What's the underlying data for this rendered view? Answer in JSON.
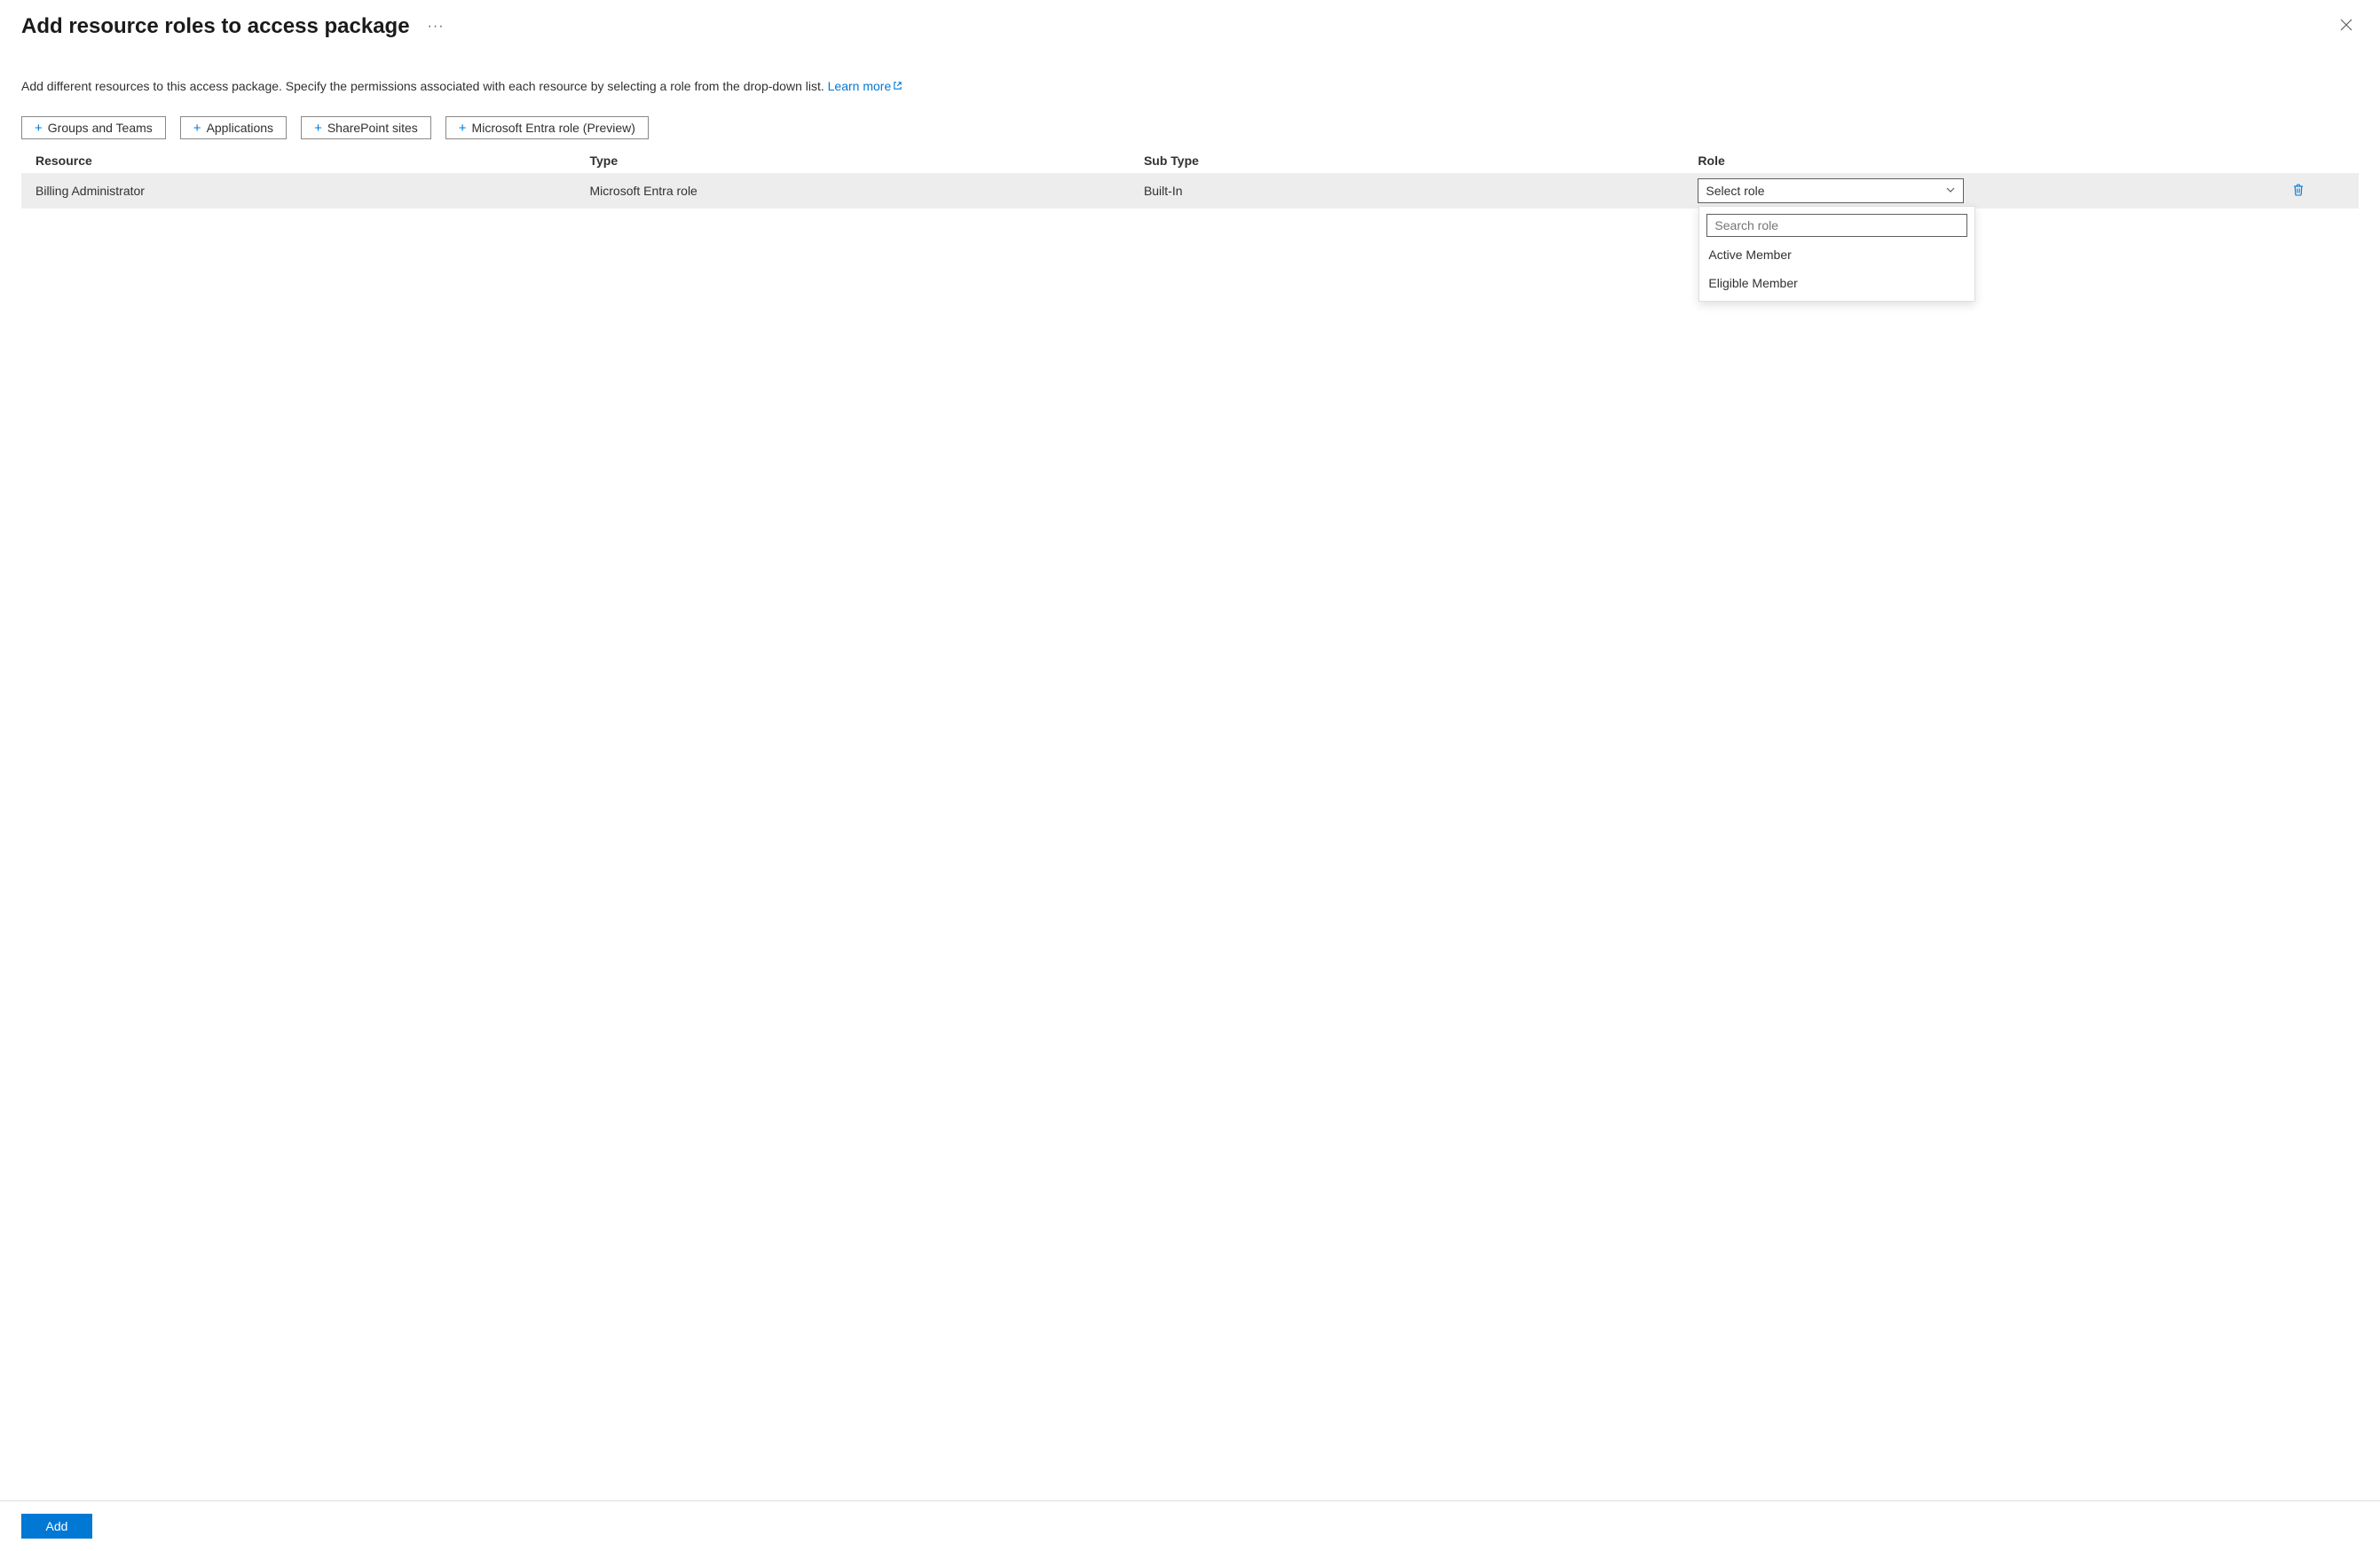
{
  "header": {
    "title": "Add resource roles to access package"
  },
  "description": {
    "text": "Add different resources to this access package. Specify the permissions associated with each resource by selecting a role from the drop-down list. ",
    "learn_more_label": "Learn more"
  },
  "resource_buttons": [
    {
      "label": "Groups and Teams"
    },
    {
      "label": "Applications"
    },
    {
      "label": "SharePoint sites"
    },
    {
      "label": "Microsoft Entra role (Preview)"
    }
  ],
  "table": {
    "headers": {
      "resource": "Resource",
      "type": "Type",
      "subtype": "Sub Type",
      "role": "Role"
    },
    "rows": [
      {
        "resource": "Billing Administrator",
        "type": "Microsoft Entra role",
        "subtype": "Built-In",
        "role_placeholder": "Select role"
      }
    ]
  },
  "role_dropdown": {
    "search_placeholder": "Search role",
    "options": [
      "Active Member",
      "Eligible Member"
    ]
  },
  "footer": {
    "add_label": "Add"
  }
}
